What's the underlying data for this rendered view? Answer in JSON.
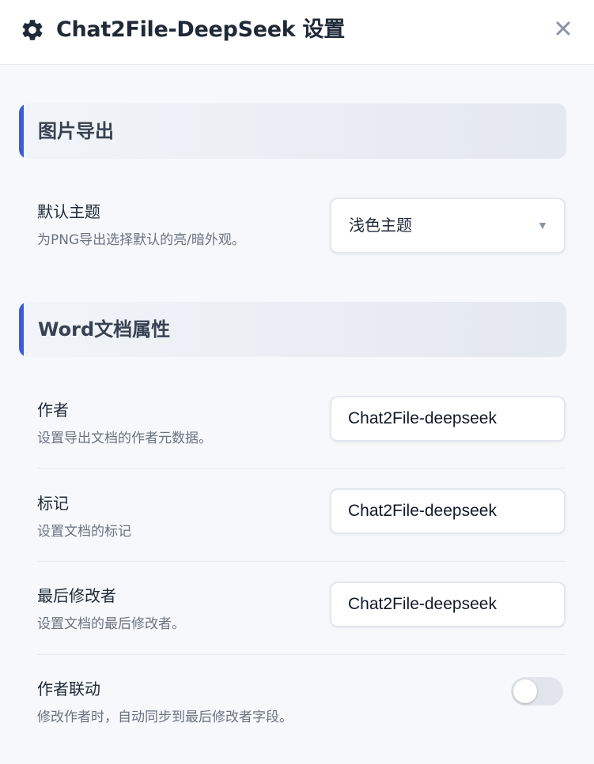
{
  "header": {
    "title": "Chat2File-DeepSeek 设置",
    "icon": "gear-icon",
    "close_icon": "close-icon"
  },
  "sections": [
    {
      "title": "图片导出",
      "settings": [
        {
          "label": "默认主题",
          "description": "为PNG导出选择默认的亮/暗外观。",
          "type": "select",
          "value": "浅色主题"
        }
      ]
    },
    {
      "title": "Word文档属性",
      "settings": [
        {
          "label": "作者",
          "description": "设置导出文档的作者元数据。",
          "type": "text",
          "value": "Chat2File-deepseek"
        },
        {
          "label": "标记",
          "description": "设置文档的标记",
          "type": "text",
          "value": "Chat2File-deepseek"
        },
        {
          "label": "最后修改者",
          "description": "设置文档的最后修改者。",
          "type": "text",
          "value": "Chat2File-deepseek"
        },
        {
          "label": "作者联动",
          "description": "修改作者时，自动同步到最后修改者字段。",
          "type": "toggle",
          "checked": false
        }
      ]
    }
  ],
  "colors": {
    "accent": "#3b5bdb",
    "background": "#f6f8fb",
    "toggle_off": "#e2e6ec"
  }
}
